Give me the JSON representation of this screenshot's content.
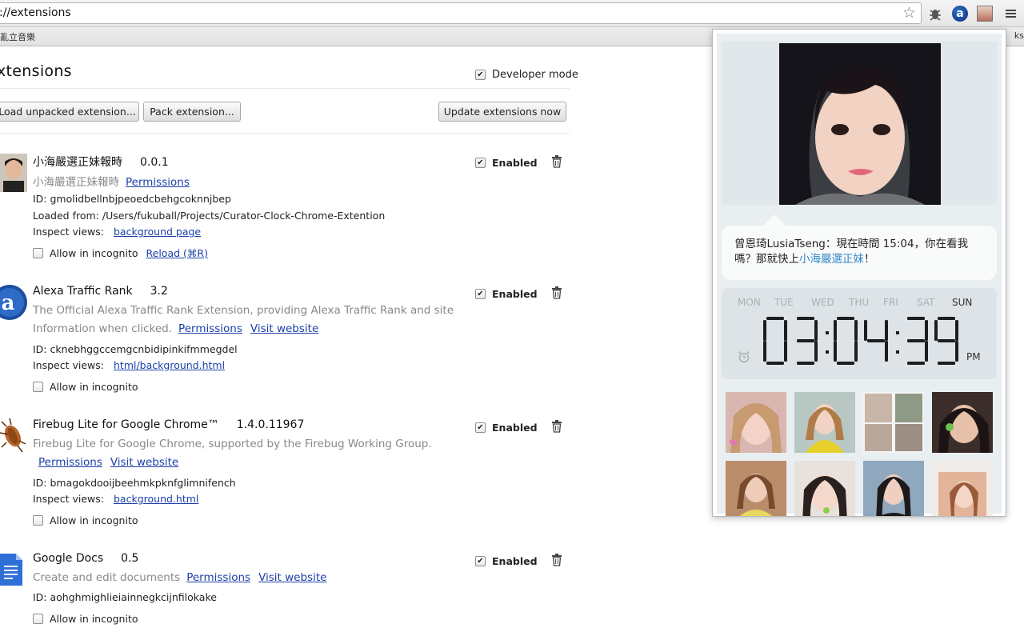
{
  "browser": {
    "url": "://extensions",
    "bookmark_left": "亂立音樂",
    "bookmark_right": "ks"
  },
  "extensions_page": {
    "title": "xtensions",
    "developer_mode_label": "Developer mode",
    "developer_mode_checked": true,
    "buttons": {
      "load_unpacked": "Load unpacked extension...",
      "pack": "Pack extension...",
      "update": "Update extensions now"
    },
    "enabled_label": "Enabled",
    "incognito_label": "Allow in incognito",
    "items": [
      {
        "name": "小海嚴選正妹報時",
        "version": "0.0.1",
        "description": "小海嚴選正妹報時",
        "permissions": "Permissions",
        "id_line": "ID: gmolidbellnbjpeoedcbehgcoknnjbep",
        "loaded_from": "Loaded from: /Users/fukuball/Projects/Curator-Clock-Chrome-Extention",
        "inspect_label": "Inspect views:",
        "inspect_link": "background page",
        "reload": "Reload (⌘R)"
      },
      {
        "name": "Alexa Traffic Rank",
        "version": "3.2",
        "description_1": "The Official Alexa Traffic Rank Extension, providing Alexa Traffic Rank and site",
        "description_2": "Information when clicked.",
        "permissions": "Permissions",
        "website": "Visit website",
        "id_line": "ID: cknebhggccemgcnbidipinkifmmegdel",
        "inspect_label": "Inspect views:",
        "inspect_link": "html/background.html"
      },
      {
        "name": "Firebug Lite for Google Chrome™",
        "version": "1.4.0.11967",
        "description": "Firebug Lite for Google Chrome, supported by the Firebug Working Group.",
        "permissions": "Permissions",
        "website": "Visit website",
        "id_line": "ID: bmagokdooijbeehmkpknfglimnifench",
        "inspect_label": "Inspect views:",
        "inspect_link": "background.html"
      },
      {
        "name": "Google Docs",
        "version": "0.5",
        "description": "Create and edit documents",
        "permissions": "Permissions",
        "website": "Visit website",
        "id_line": "ID: aohghmighlieiainnegkcijnfilokake"
      }
    ]
  },
  "popup": {
    "message_prefix": "曾恩琦LusiaTseng：現在時間 15:04，你在看我嗎？那就快上",
    "message_link": "小海嚴選正妹",
    "message_suffix": "！",
    "days": [
      "MON",
      "TUE",
      "WED",
      "THU",
      "FRI",
      "SAT",
      "SUN"
    ],
    "active_day": "SUN",
    "time": "03:04:39",
    "ampm": "PM"
  },
  "colors": {
    "link": "#1c3fa8",
    "highlight": "#2f87c8",
    "popup_bg": "#e9eef1"
  }
}
